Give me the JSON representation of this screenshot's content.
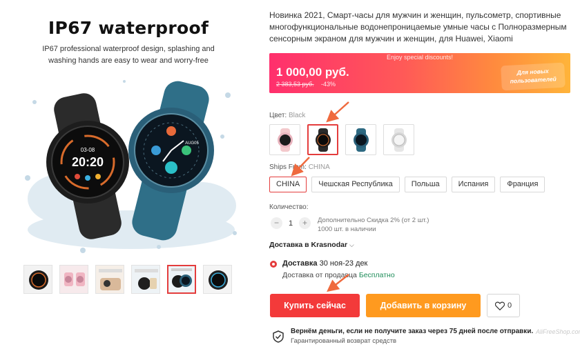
{
  "gallery": {
    "hero_title": "IP67 waterproof",
    "hero_subtitle": "IP67 professional waterproof design, splashing and washing hands are easy to wear and worry-free",
    "watch_screen_date": "03-08",
    "watch_screen_time": "20:20",
    "watch_screen_date_2": "AUG05",
    "thumbnails": [
      {
        "name": "thumb-black-watch",
        "caption": ""
      },
      {
        "name": "thumb-pink-watch",
        "caption": ""
      },
      {
        "name": "thumb-lightweight",
        "caption": "Lightweight design"
      },
      {
        "name": "thumb-weather",
        "caption": "Weather forecast"
      },
      {
        "name": "thumb-ip67",
        "caption": "IP67 waterproof"
      },
      {
        "name": "thumb-dial",
        "caption": ""
      }
    ],
    "active_thumbnail_index": 4
  },
  "product": {
    "title": "Новинка 2021, Смарт-часы для мужчин и женщин, пульсометр, спортивные многофункциональные водонепроницаемые умные часы с Полноразмерным сенсорным экраном для мужчин и женщин, для Huawei, Xiaomi",
    "special_label": "Enjoy special discounts!",
    "price": "1 000,00 руб.",
    "old_price": "2 383,53 руб.",
    "discount": "-43%",
    "promo_badge": "Для новых пользователей",
    "color_label": "Цвет:",
    "color_value": "Black",
    "colors": [
      {
        "name": "Pink",
        "dial": "#f3c9cc",
        "face": "#c8869a"
      },
      {
        "name": "Black",
        "dial": "#2a2a2a",
        "face": "#121212"
      },
      {
        "name": "Blue",
        "dial": "#2e6a82",
        "face": "#0f2f40"
      },
      {
        "name": "Silver",
        "dial": "#e3e3e3",
        "face": "#cfcfcf"
      }
    ],
    "selected_color_index": 1,
    "ships_from_label": "Ships From:",
    "ships_from_value": "CHINA",
    "ships_from": [
      "CHINA",
      "Чешская Республика",
      "Польша",
      "Испания",
      "Франция"
    ],
    "selected_ship_index": 0,
    "quantity_label": "Количество:",
    "quantity": "1",
    "qty_minus": "−",
    "qty_plus": "+",
    "quantity_discount": "Дополнительно Скидка 2% (от 2 шт.)",
    "stock": "1000 шт. в наличии",
    "delivery_to": "Доставка в Krasnodar",
    "delivery_title": "Доставка",
    "delivery_dates": "30 ноя-23 дек",
    "delivery_from_text": "Доставка от продавца",
    "delivery_price": "Бесплатно",
    "buy_now": "Купить сейчас",
    "add_to_cart": "Добавить в корзину",
    "wishlist_count": "0",
    "guarantee_title": "Вернём деньги, если не получите заказ через 75 дней после отправки.",
    "guarantee_sub": "Гарантированный возврат средств",
    "watermark": "AliFreeShop.com"
  },
  "colors": {
    "accent_red": "#e43c3c",
    "buy_red": "#f33a3a",
    "cart_orange": "#ff9a1f",
    "free_green": "#1d8c58"
  }
}
